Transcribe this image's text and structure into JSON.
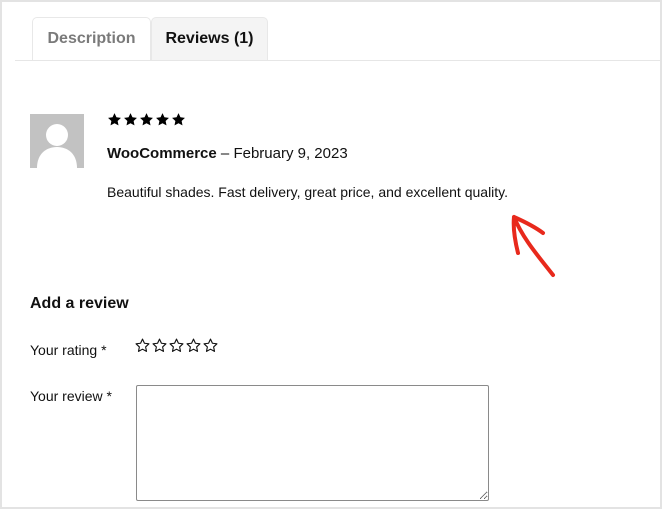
{
  "tabs": [
    {
      "label": "Description",
      "active": false
    },
    {
      "label": "Reviews (1)",
      "active": true
    }
  ],
  "review": {
    "rating": 5,
    "max_rating": 5,
    "author": "WooCommerce",
    "separator": " – ",
    "date": "February 9, 2023",
    "text": "Beautiful shades. Fast delivery, great price, and excellent quality."
  },
  "annotation": {
    "arrow_color": "#e8291c"
  },
  "form": {
    "heading": "Add a review",
    "rating_label": "Your rating *",
    "rating_options": 5,
    "review_label": "Your review *",
    "review_value": "",
    "review_placeholder": ""
  },
  "colors": {
    "avatar_bg": "#c2c2c2",
    "active_tab_bg": "#f4f4f4",
    "inactive_tab_text": "#7a7a7a"
  }
}
